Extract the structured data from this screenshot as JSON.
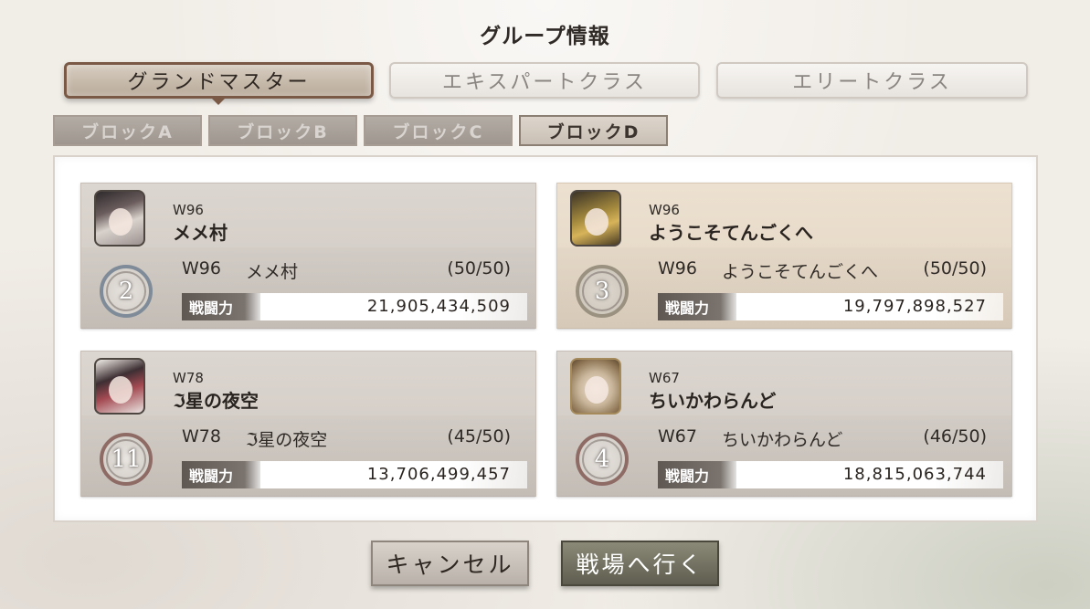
{
  "dialog": {
    "title": "グループ情報"
  },
  "class_tabs": [
    {
      "label": "グランドマスター",
      "active": true
    },
    {
      "label": "エキスパートクラス",
      "active": false
    },
    {
      "label": "エリートクラス",
      "active": false
    }
  ],
  "block_tabs": [
    {
      "label": "ブロックA",
      "active": false
    },
    {
      "label": "ブロックB",
      "active": false
    },
    {
      "label": "ブロックC",
      "active": false
    },
    {
      "label": "ブロックD",
      "active": true
    }
  ],
  "groups": [
    {
      "world": "W96",
      "name": "メメ村",
      "rank": "2",
      "members": "(50/50)",
      "power_label": "戦闘力",
      "power": "21,905,434,509",
      "avatar": "avatar-icon"
    },
    {
      "world": "W96",
      "name": "ようこそてんごくへ",
      "rank": "3",
      "members": "(50/50)",
      "power_label": "戦闘力",
      "power": "19,797,898,527",
      "avatar": "avatar-icon"
    },
    {
      "world": "W78",
      "name": "ℑ星の夜空",
      "rank": "11",
      "members": "(45/50)",
      "power_label": "戦闘力",
      "power": "13,706,499,457",
      "avatar": "avatar-icon"
    },
    {
      "world": "W67",
      "name": "ちいかわらんど",
      "rank": "4",
      "members": "(46/50)",
      "power_label": "戦闘力",
      "power": "18,815,063,744",
      "avatar": "avatar-icon"
    }
  ],
  "buttons": {
    "cancel": "キャンセル",
    "go": "戦場へ行く"
  },
  "colors": {
    "highlight_card": "#ece0d0",
    "card": "#dcd6d0",
    "active_tab_border": "#7a5a46"
  }
}
